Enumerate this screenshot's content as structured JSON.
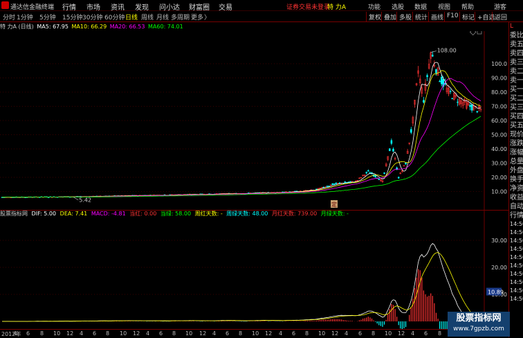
{
  "titlebar": {
    "app_name": "通达信金融终端",
    "menus": [
      "行情",
      "市场",
      "资讯",
      "发现",
      "问小达",
      "财富圈",
      "交易"
    ],
    "warning": "证券交易未登录",
    "symbol": "特 力A",
    "right_menus": [
      "功能",
      "选股",
      "数据",
      "视图",
      "帮助",
      "游客"
    ]
  },
  "toolbar": {
    "periods": [
      "分时",
      "1分钟",
      "5分钟",
      "15分钟",
      "30分钟",
      "60分钟",
      "日线",
      "周线",
      "月线",
      "多周期",
      "更多"
    ],
    "active_period": "日线",
    "more_arrow": "〉",
    "buttons": [
      "复权",
      "叠加",
      "多股",
      "统计",
      "画线",
      "F10",
      "标记",
      "+自选",
      "返回"
    ]
  },
  "main_info": {
    "name": "特 力A (日线)",
    "ma5": "MA5: 67.95",
    "ma10": "MA10: 66.29",
    "ma20": "MA20: 66.53",
    "ma60": "MA60: 74.01"
  },
  "main_axis": {
    "y_ticks": [
      "100.0",
      "90.00",
      "80.00",
      "70.00",
      "60.00",
      "50.00",
      "40.00",
      "30.00",
      "20.00",
      "10.00"
    ],
    "high_label": "108.00",
    "low_label": "5.42",
    "note_label": "定"
  },
  "sub_info": {
    "title": "股票指标网",
    "dif": "DIF: 5.00",
    "dea": "DEA: 7.41",
    "macd": "MACD: -4.81",
    "dang_hong": "当红: 0.00",
    "dang_lv": "当绿: 58.00",
    "zhou_hong": "周红天数: -",
    "zhou_lv": "周绿天数: 48.00",
    "yue_hong": "月红天数: 739.00",
    "yue_lv": "月绿天数: -"
  },
  "sub_axis": {
    "y_ticks": [
      "30.00",
      "20.00",
      "10.00",
      "0.00"
    ],
    "current_value": "10.89"
  },
  "x_axis": {
    "labels": [
      "2012年",
      "4",
      "6",
      "8",
      "10",
      "12",
      "4",
      "6",
      "8",
      "10",
      "12",
      "4",
      "6",
      "8",
      "10",
      "12",
      "4",
      "6",
      "8",
      "10",
      "12",
      "4",
      "6",
      "8",
      "10",
      "12",
      "4",
      "6",
      "8",
      "10",
      "12",
      "4",
      "6",
      "8",
      "10",
      "12",
      "2"
    ]
  },
  "right_panel": {
    "header": "L",
    "items": [
      "委比",
      "卖五",
      "卖四",
      "卖三",
      "卖二",
      "卖一",
      "买一",
      "买二",
      "买三",
      "买四",
      "买五",
      "现价",
      "涨跌",
      "涨幅",
      "总量",
      "外盘",
      "换手",
      "净资",
      "收益",
      "自动",
      "行情",
      "14:50",
      "14:50",
      "14:50",
      "14:50",
      "14:50",
      "14:50",
      "14:50",
      "14:50",
      "14:50",
      "14:50"
    ]
  },
  "watermark": {
    "line1": "股票指标网",
    "line2": "www.7gpzb.com"
  },
  "colors": {
    "ma5": "#ffffff",
    "ma10": "#ffff00",
    "ma20": "#ff00ff",
    "ma60": "#00ff00",
    "up": "#ff3333",
    "down": "#00ffff",
    "grid": "#700000"
  }
}
